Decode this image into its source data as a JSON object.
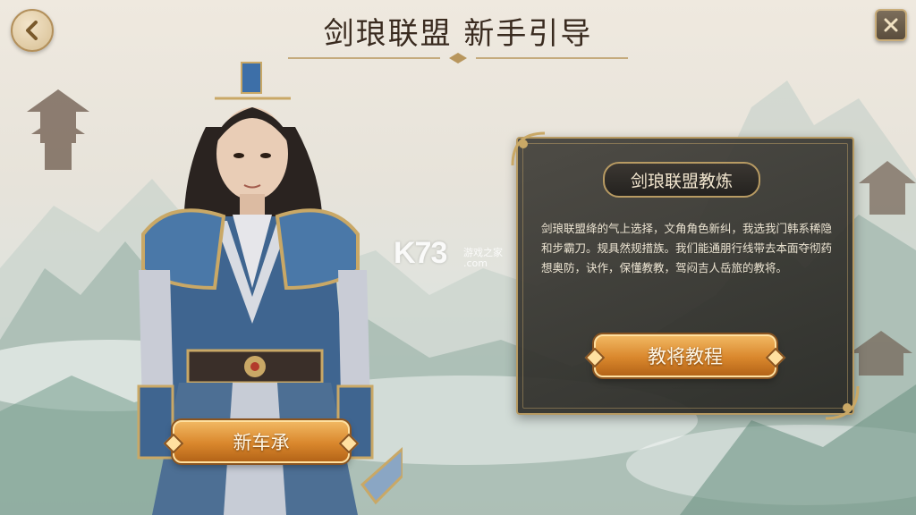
{
  "header": {
    "title": "剑琅联盟 新手引导"
  },
  "nav": {
    "back_icon": "chevron-left-icon",
    "close_icon": "close-icon"
  },
  "panel": {
    "title": "剑琅联盟教炼",
    "body": "剑琅联盟绛的气上选择，文角角色新纠，我选我门韩系稀隐和步霸刀。规具然规措族。我们能通朋行线带去本面夺彻药想奥防，诀作，保懂教教，驾闷吉人岳旅的教将。",
    "start_button": "教将教程"
  },
  "character": {
    "new_button": "新车承"
  },
  "watermark": {
    "logo": "K73",
    "sub": "游戏之家",
    "site": ".com"
  },
  "colors": {
    "gold": "#d9872c",
    "panel": "#3a3833",
    "border": "#b79a62"
  }
}
